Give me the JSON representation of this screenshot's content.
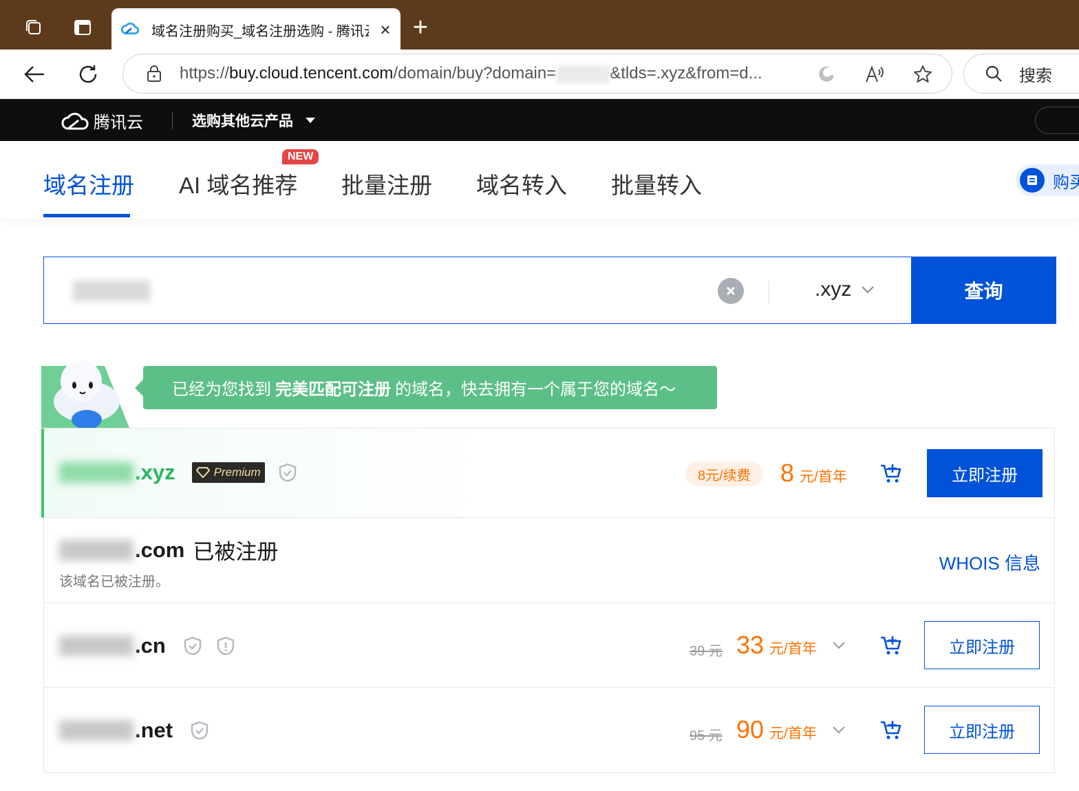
{
  "browser": {
    "tab_title": "域名注册购买_域名注册选购 - 腾讯云",
    "url_scheme": "https://",
    "url_host": "buy.cloud.tencent.com",
    "url_path_before": "/domain/buy?domain=",
    "url_path_after": "&tlds=.xyz&from=d...",
    "search_label": "搜索"
  },
  "header": {
    "brand": "腾讯云",
    "menu_label": "选购其他云产品"
  },
  "tabs": [
    {
      "label": "域名注册",
      "active": true
    },
    {
      "label": "AI 域名推荐",
      "badge": "NEW"
    },
    {
      "label": "批量注册"
    },
    {
      "label": "域名转入"
    },
    {
      "label": "批量转入"
    }
  ],
  "buy_chip_label": "购买",
  "search": {
    "tld": ".xyz",
    "button_label": "查询"
  },
  "banner": {
    "prefix": "已经为您找到",
    "highlight": "完美匹配可注册",
    "suffix": "的域名，快去拥有一个属于您的域名～"
  },
  "results": [
    {
      "tld": ".xyz",
      "premium_label": "Premium",
      "renew_label": "8元/续费",
      "price": "8",
      "price_unit": "元/首年",
      "button": "立即注册"
    },
    {
      "tld": ".com",
      "status": "已被注册",
      "note": "该域名已被注册。",
      "whois": "WHOIS 信息"
    },
    {
      "tld": ".cn",
      "old_price": "39 元",
      "price": "33",
      "price_unit": "元/首年",
      "button": "立即注册"
    },
    {
      "tld": ".net",
      "old_price": "95 元",
      "price": "90",
      "price_unit": "元/首年",
      "button": "立即注册"
    }
  ],
  "colors": {
    "brand_blue": "#0052d9",
    "price_orange": "#ff7200",
    "banner_green": "#5cbf87",
    "tabbar_brown": "#5e3a1d"
  }
}
